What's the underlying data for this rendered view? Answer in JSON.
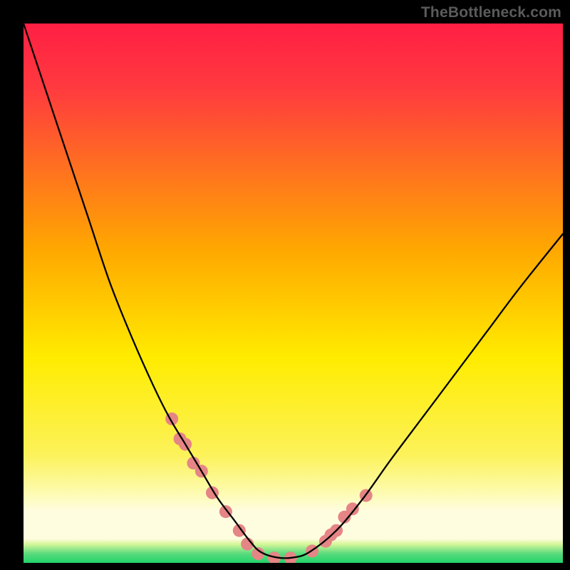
{
  "watermark": "TheBottleneck.com",
  "chart_data": {
    "type": "line",
    "title": "",
    "xlabel": "",
    "ylabel": "",
    "xlim": [
      0,
      100
    ],
    "ylim": [
      0,
      100
    ],
    "gradient_colors": {
      "top": "#ff1f44",
      "mid_upper": "#ffa800",
      "mid": "#ffec00",
      "mid_lower": "#fdfbb0",
      "band": "#fffde0",
      "bottom": "#22d36a"
    },
    "series": [
      {
        "name": "bottleneck-curve",
        "x": [
          0,
          4,
          8,
          12,
          16,
          20,
          24,
          27,
          30,
          33,
          36,
          39,
          42,
          44,
          47,
          50,
          53,
          58,
          63,
          68,
          74,
          80,
          86,
          92,
          100
        ],
        "values": [
          100,
          88,
          76,
          64,
          52,
          42,
          33,
          27,
          22,
          17,
          12,
          8,
          4,
          2,
          1,
          1,
          2,
          6,
          12,
          19,
          27,
          35,
          43,
          51,
          61
        ]
      }
    ],
    "markers": {
      "name": "fit-range-dots",
      "color": "#e58585",
      "radius": 9,
      "x": [
        27.5,
        29.0,
        30.0,
        31.5,
        33.0,
        35.0,
        37.5,
        40.0,
        41.5,
        43.5,
        46.5,
        49.5,
        53.5,
        56.0,
        57.0,
        58.0,
        59.5,
        61.0,
        63.5
      ],
      "values": [
        26.7,
        23.0,
        22.0,
        18.5,
        17.0,
        13.0,
        9.5,
        6.0,
        3.5,
        1.7,
        0.9,
        0.9,
        2.2,
        4.0,
        5.2,
        6.0,
        8.5,
        10.0,
        12.5
      ]
    }
  }
}
